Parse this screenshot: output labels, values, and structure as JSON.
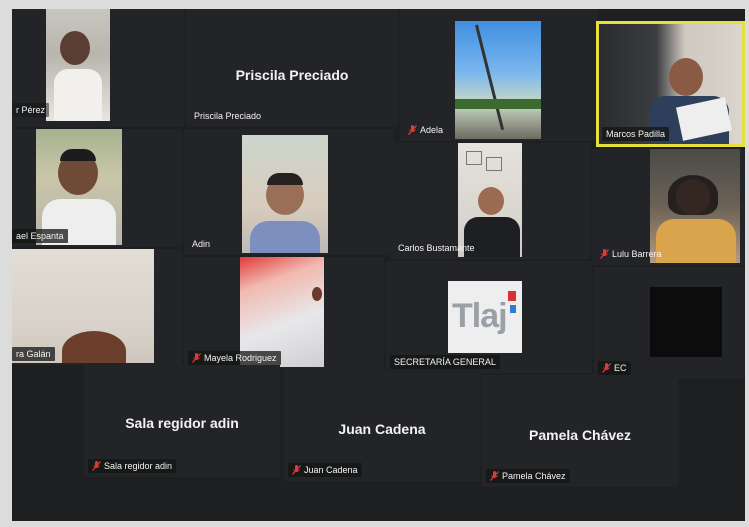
{
  "participants": {
    "p1": {
      "name": "r Pérez",
      "muted": false
    },
    "p2": {
      "name": "Priscila Preciado",
      "muted": false
    },
    "p3": {
      "name": "Adela",
      "muted": true
    },
    "p4": {
      "name": "Marcos Padilla",
      "muted": false
    },
    "p5": {
      "name": "ael Espanta",
      "muted": false
    },
    "p6": {
      "name": "Adin",
      "muted": false
    },
    "p7": {
      "name": "Carlos Bustamante",
      "muted": false
    },
    "p8": {
      "name": "Lulu Barrera",
      "muted": true
    },
    "p9": {
      "name": "ra Galán",
      "muted": false
    },
    "p10": {
      "name": "Mayela Rodriguez",
      "muted": true
    },
    "p11": {
      "name": "SECRETARÍA GENERAL",
      "muted": false,
      "logo_text": "Tlaj"
    },
    "p12": {
      "name": "EC",
      "muted": true
    },
    "p13": {
      "name": "Sala regidor adin",
      "muted": true
    },
    "p14": {
      "name": "Juan Cadena",
      "muted": true
    },
    "p15": {
      "name": "Pamela Chávez",
      "muted": true
    }
  },
  "overlay_names": {
    "priscila_big": "Priscila Preciado",
    "sala_big": "Sala regidor adin",
    "juan_big": "Juan Cadena",
    "pamela_big": "Pamela Chávez"
  },
  "colors": {
    "active_speaker_border": "#e6df3c",
    "muted_icon": "#e03a3a",
    "tile_bg": "#232427"
  },
  "icons": {
    "muted": "microphone-muted-icon"
  }
}
